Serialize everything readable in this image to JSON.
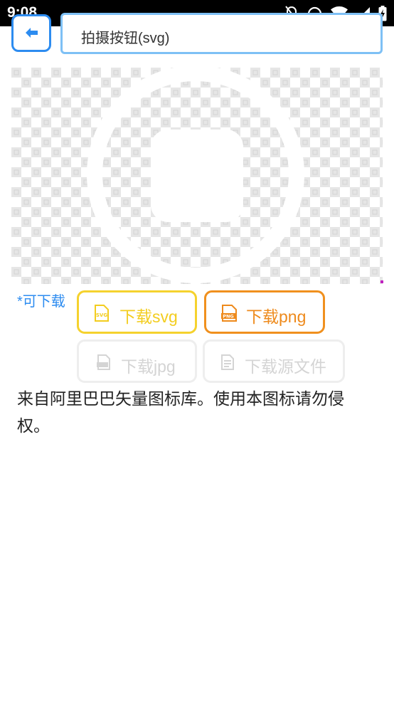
{
  "status_bar": {
    "time": "9:08",
    "icons": [
      "notifications-off-icon",
      "do-not-disturb-icon",
      "wifi-icon",
      "signal-icon",
      "battery-charging-icon"
    ]
  },
  "header": {
    "back_icon": "arrow-left-icon",
    "title": "拍摄按钮(svg)"
  },
  "preview": {
    "background": "transparency-checkerboard",
    "icon": "camera-shutter-button-icon",
    "icon_color": "#ffffff"
  },
  "download": {
    "label": "*可下载",
    "buttons": [
      {
        "label": "下载svg",
        "icon": "svg-file-icon",
        "color": "#f3cd1f",
        "enabled": true
      },
      {
        "label": "下载png",
        "icon": "png-file-icon",
        "color": "#ee8a1c",
        "enabled": true
      },
      {
        "label": "下载jpg",
        "icon": "jpg-file-icon",
        "color": "#d4d4d4",
        "enabled": false
      },
      {
        "label": "下载源文件",
        "icon": "source-file-icon",
        "color": "#d4d4d4",
        "enabled": false
      }
    ]
  },
  "notice": "来自阿里巴巴矢量图标库。使用本图标请勿侵权。",
  "colors": {
    "accent": "#2d8cf0",
    "title_border": "#7ec0f5"
  }
}
